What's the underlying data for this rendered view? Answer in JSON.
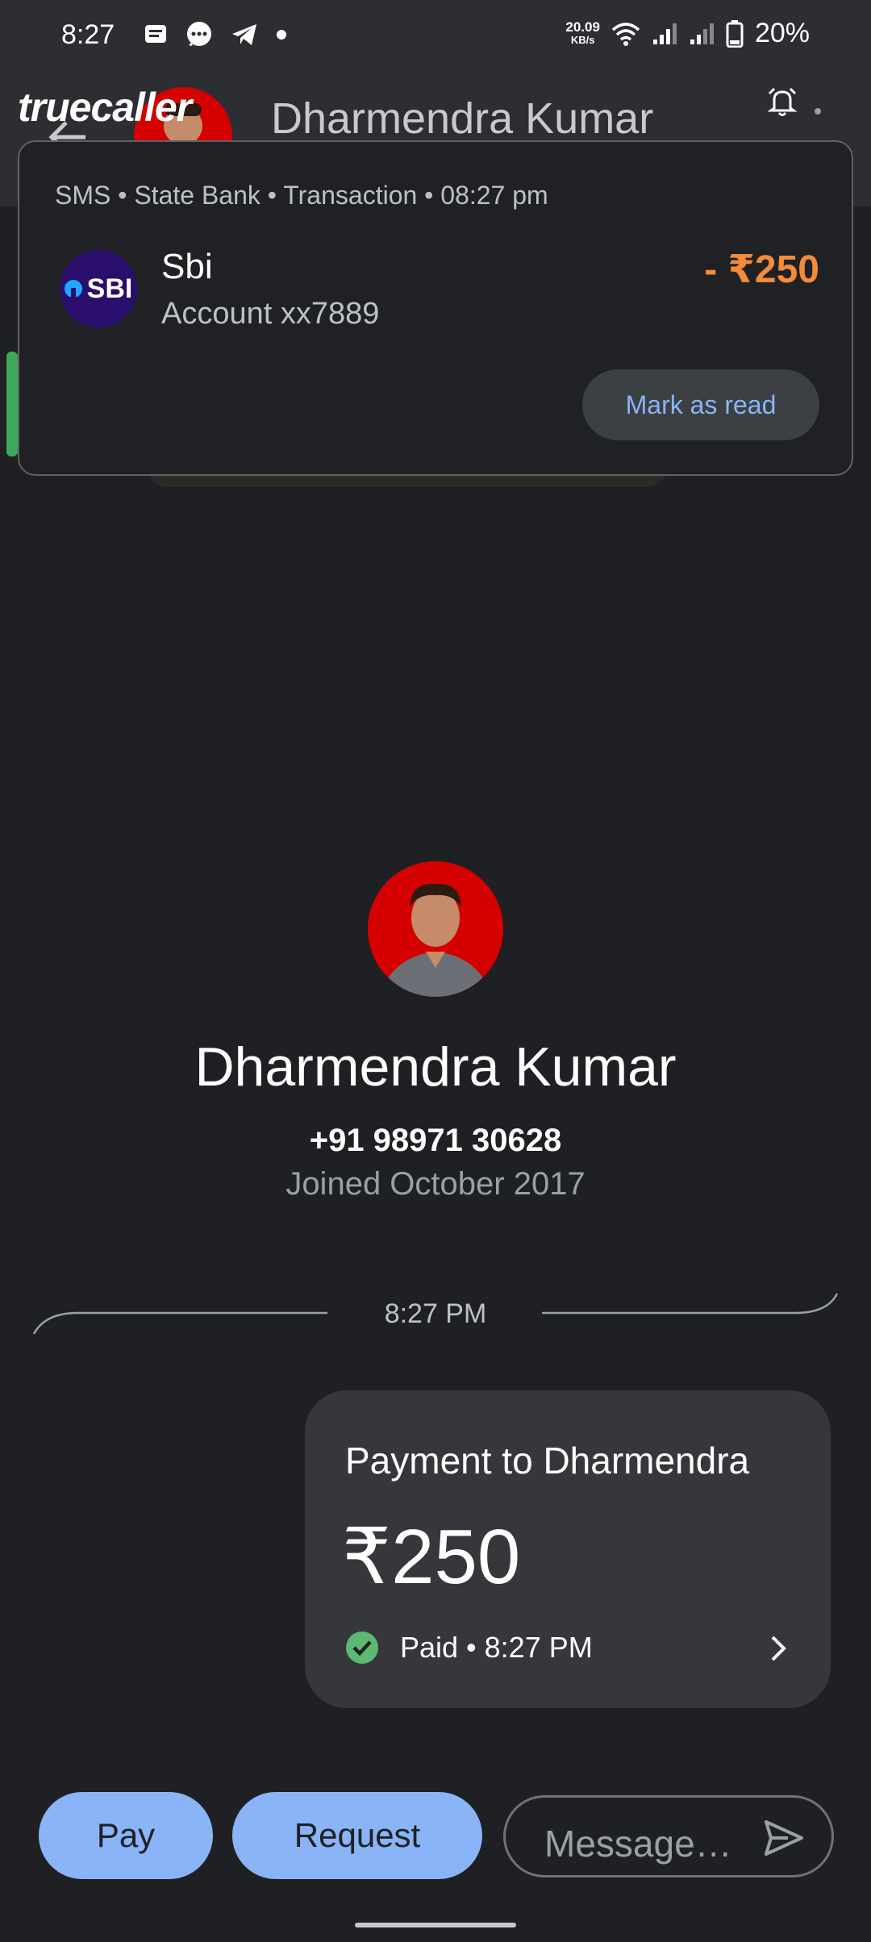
{
  "status_bar": {
    "time": "8:27",
    "speed_value": "20.09",
    "speed_unit": "KB/s",
    "battery": "20%",
    "icons": [
      "message-icon",
      "chat-icon",
      "telegram-icon",
      "dot-icon",
      "wifi-icon",
      "signal-icon",
      "signal-icon-2",
      "battery-icon"
    ]
  },
  "app_bar": {
    "contact_name": "Dharmendra Kumar",
    "icons": [
      "back-arrow-icon",
      "alarm-bell-icon",
      "overflow-menu-icon"
    ]
  },
  "overlay": {
    "brand": "truecaller"
  },
  "notification": {
    "header": "SMS • State Bank • Transaction • 08:27 pm",
    "logo_text": "SBI",
    "title": "Sbi",
    "subtitle": "Account xx7889",
    "amount": "- ₹250",
    "action_label": "Mark as read",
    "colors": {
      "amount": "#f28b3a",
      "action": "#8ab4f8"
    }
  },
  "profile": {
    "name": "Dharmendra Kumar",
    "phone": "+91 98971 30628",
    "joined": "Joined October 2017"
  },
  "conversation": {
    "divider_time": "8:27 PM",
    "payment": {
      "title": "Payment to Dharmendra",
      "amount": "₹250",
      "status": "Paid • 8:27 PM",
      "status_color": "#5bb974"
    }
  },
  "bottom_bar": {
    "pay_label": "Pay",
    "request_label": "Request",
    "message_placeholder": "Message…",
    "accent": "#8ab4f8"
  }
}
